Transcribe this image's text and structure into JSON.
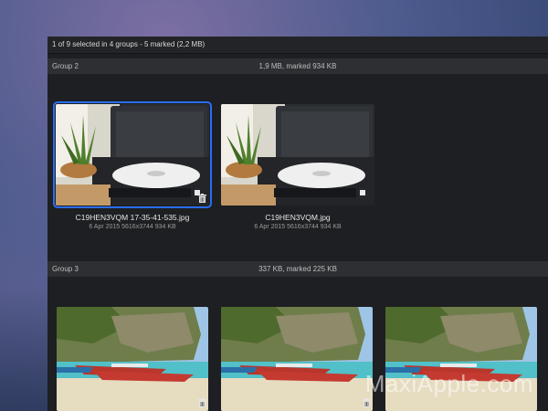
{
  "status": {
    "text": "1 of 9 selected in 4 groups - 5 marked (2,2 MB)"
  },
  "groups": [
    {
      "name": "Group 2",
      "info": "1,9 MB, marked 934 KB",
      "items": [
        {
          "filename": "C19HEN3VQM 17-35-41-535.jpg",
          "meta": "6 Apr 2015  5616x3744  934 KB",
          "selected": true,
          "marked": true,
          "icon": "trash-icon"
        },
        {
          "filename": "C19HEN3VQM.jpg",
          "meta": "6 Apr 2015  5616x3744  934 KB",
          "selected": false,
          "marked": false
        }
      ]
    },
    {
      "name": "Group 3",
      "info": "337 KB, marked 225 KB",
      "items": [
        {
          "marked": true,
          "icon": "trash-icon"
        },
        {
          "marked": true,
          "icon": "trash-icon"
        },
        {
          "marked": false
        }
      ]
    }
  ],
  "watermark": "MaxiApple.com",
  "colors": {
    "selection": "#2a6df5",
    "window_bg": "#1e1f22",
    "header_bg": "#2e2f33"
  }
}
